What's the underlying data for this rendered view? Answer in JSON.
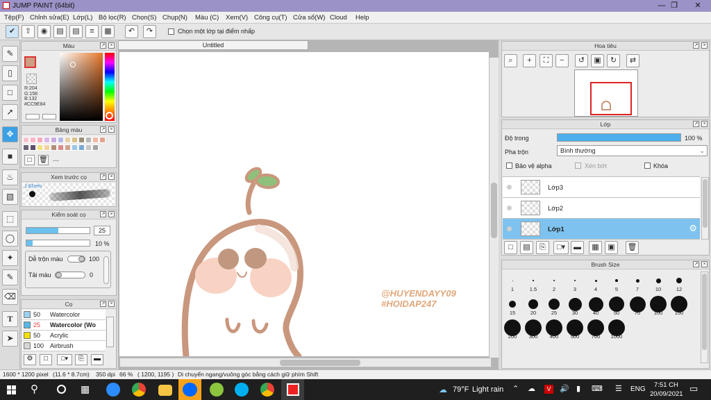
{
  "window": {
    "title": "JUMP PAINT (64bit)"
  },
  "menu": [
    "Tệp(F)",
    "Chỉnh sửa(E)",
    "Lớp(L)",
    "Bộ lọc(R)",
    "Chọn(S)",
    "Chụp(N)",
    "Màu (C)",
    "Xem(V)",
    "Công cụ(T)",
    "Cửa sổ(W)",
    "Cloud",
    "Help"
  ],
  "toolbar": {
    "checkbox_label": "Chọn một lớp tại điểm nhấp"
  },
  "color_panel": {
    "title": "Màu",
    "r": "R:204",
    "g": "G:158",
    "b": "B:132",
    "hex": "#CC9E84",
    "fg": "#cc9e84"
  },
  "palette_panel": {
    "title": "Bảng màu",
    "more": "---",
    "swatches": [
      "#f7c3cf",
      "#f9b5c6",
      "#f5a9bb",
      "#d8b8e8",
      "#c9a9e0",
      "#b6b9e8",
      "#e6d0a8",
      "#d9c28a",
      "#9a8f78",
      "#b8b8b8",
      "#f2b9a3",
      "#e2a58f",
      "#6b6178",
      "#5c4e6d",
      "#f2e27d",
      "#f4cfa0",
      "#b08e7a",
      "#d98b8b",
      "#cfa48c",
      "#9bc7e8",
      "#7aa9d6",
      "#c7c7c7",
      "#a2a2a2"
    ]
  },
  "brush_preview": {
    "title": "Xem trước cọ",
    "size": "1.81mm"
  },
  "control_panel": {
    "title": "Kiểm soát cọ",
    "size_value": "25",
    "opacity_value": "10 %",
    "blend_label": "Dễ trộn màu",
    "blend_value": "100",
    "reload_label": "Tải màu",
    "reload_value": "0",
    "size_fill": 0.5,
    "opacity_fill": 0.1
  },
  "brush_list": {
    "title": "Cọ",
    "items": [
      {
        "size": "50",
        "name": "Watercolor",
        "color": "#9bd0ee",
        "selected": false
      },
      {
        "size": "25",
        "name": "Watercolor (Wo",
        "color": "#58b8e8",
        "selected": true
      },
      {
        "size": "50",
        "name": "Acrylic",
        "color": "#f2e100",
        "selected": false
      },
      {
        "size": "100",
        "name": "Airbrush",
        "color": "#d6d6d6",
        "selected": false
      }
    ]
  },
  "document": {
    "tab": "Untitled"
  },
  "artwork": {
    "watermark1": "@HUYENDAYY09",
    "watermark2": "#HOIDAP247",
    "line_color": "#c9977d",
    "cheek_color": "#f8d3c4",
    "eye_color": "#c0977f",
    "sprout_color": "#8ec07c"
  },
  "navigator": {
    "title": "Hoa tiêu"
  },
  "layer_panel": {
    "title": "Lớp",
    "opacity_label": "Độ trong",
    "opacity_value": "100 %",
    "opacity_fill": 1.0,
    "blend_label": "Pha trộn",
    "blend_mode": "Bình thường",
    "protect_alpha": "Bảo vệ alpha",
    "clip": "Xén bớt",
    "lock": "Khóa",
    "layers": [
      {
        "name": "Lớp3",
        "selected": false
      },
      {
        "name": "Lớp2",
        "selected": false
      },
      {
        "name": "Lớp1",
        "selected": true
      }
    ]
  },
  "brush_size_panel": {
    "title": "Brush Size",
    "sizes": [
      {
        "label": "1",
        "d": 1
      },
      {
        "label": "1.5",
        "d": 1.5
      },
      {
        "label": "2",
        "d": 2
      },
      {
        "label": "3",
        "d": 2.5
      },
      {
        "label": "4",
        "d": 3
      },
      {
        "label": "5",
        "d": 3.5
      },
      {
        "label": "7",
        "d": 5
      },
      {
        "label": "10",
        "d": 7
      },
      {
        "label": "12",
        "d": 8
      },
      {
        "label": "15",
        "d": 10
      },
      {
        "label": "20",
        "d": 14
      },
      {
        "label": "25",
        "d": 16
      },
      {
        "label": "30",
        "d": 19
      },
      {
        "label": "40",
        "d": 21
      },
      {
        "label": "50",
        "d": 22
      },
      {
        "label": "70",
        "d": 23
      },
      {
        "label": "100",
        "d": 24
      },
      {
        "label": "150",
        "d": 24
      },
      {
        "label": "200",
        "d": 24
      },
      {
        "label": "300",
        "d": 24
      },
      {
        "label": "400",
        "d": 24
      },
      {
        "label": "500",
        "d": 24
      },
      {
        "label": "700",
        "d": 24
      },
      {
        "label": "1000",
        "d": 24
      }
    ]
  },
  "status": {
    "dims": "1600 * 1200 pixel",
    "phys": "(11.6 * 8.7cm)",
    "dpi": "350 dpi",
    "zoom": "66 %",
    "coords": "( 1200, 1195 )",
    "hint": "Di chuyển ngang/vuông góc bằng cách giữ phím Shift"
  },
  "taskbar": {
    "weather_temp": "79°F",
    "weather_text": "Light rain",
    "lang": "ENG",
    "time": "7:51 CH",
    "date": "20/09/2021"
  }
}
